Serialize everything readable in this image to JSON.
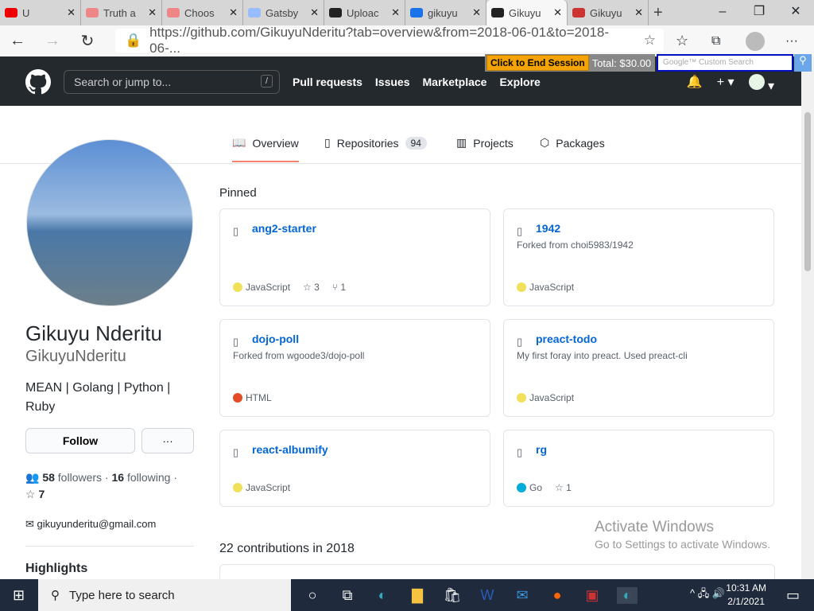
{
  "browser": {
    "tabs": [
      {
        "label": "U",
        "color": "#e00"
      },
      {
        "label": "Truth a",
        "color": "#e88"
      },
      {
        "label": "Choos",
        "color": "#e88"
      },
      {
        "label": "Gatsby",
        "color": "#9bf"
      },
      {
        "label": "Uploac",
        "color": "#222"
      },
      {
        "label": "gikuyu",
        "color": "#1a73e8"
      },
      {
        "label": "Gikuyu",
        "color": "#222",
        "active": true
      },
      {
        "label": "Gikuyu",
        "color": "#c33"
      }
    ],
    "url": "https://github.com/GikuyuNderitu?tab=overview&from=2018-06-01&to=2018-06-..."
  },
  "overlay": {
    "end_session": "Click to End Session",
    "total": "Total: $30.00",
    "google_placeholder": "Google™ Custom Search"
  },
  "github": {
    "search_placeholder": "Search or jump to...",
    "slash": "/",
    "nav": [
      "Pull requests",
      "Issues",
      "Marketplace",
      "Explore"
    ]
  },
  "profile_tabs": [
    {
      "label": "Overview"
    },
    {
      "label": "Repositories",
      "count": "94"
    },
    {
      "label": "Projects"
    },
    {
      "label": "Packages"
    }
  ],
  "profile": {
    "name": "Gikuyu Nderitu",
    "login": "GikuyuNderitu",
    "bio": "MEAN | Golang | Python | Ruby",
    "follow": "Follow",
    "more": "···",
    "followers": "58",
    "followers_label": "followers ·",
    "following": "16",
    "following_label": "following ·",
    "stars": "7",
    "email": "gikuyunderitu@gmail.com",
    "highlights": "Highlights"
  },
  "pinned": {
    "heading": "Pinned",
    "repos": [
      {
        "name": "ang2-starter",
        "desc": "",
        "lang": "JavaScript",
        "color": "#f1e05a",
        "stars": "3",
        "forks": "1"
      },
      {
        "name": "1942",
        "desc": "Forked from choi5983/1942",
        "lang": "JavaScript",
        "color": "#f1e05a"
      },
      {
        "name": "dojo-poll",
        "desc": "Forked from wgoode3/dojo-poll",
        "lang": "HTML",
        "color": "#e34c26"
      },
      {
        "name": "preact-todo",
        "desc": "My first foray into preact. Used preact-cli",
        "lang": "JavaScript",
        "color": "#f1e05a"
      },
      {
        "name": "react-albumify",
        "desc": "",
        "lang": "JavaScript",
        "color": "#f1e05a"
      },
      {
        "name": "rg",
        "desc": "",
        "lang": "Go",
        "color": "#00ADD8",
        "stars": "1"
      }
    ]
  },
  "contributions": "22 contributions in 2018",
  "watermark": {
    "title": "Activate Windows",
    "sub": "Go to Settings to activate Windows."
  },
  "taskbar": {
    "search": "Type here to search",
    "time": "10:31 AM",
    "date": "2/1/2021"
  }
}
